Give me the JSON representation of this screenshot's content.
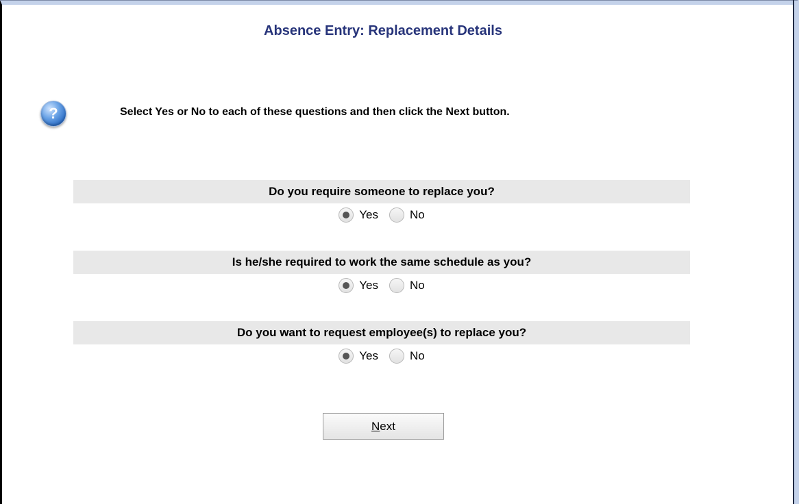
{
  "page": {
    "title": "Absence Entry: Replacement Details",
    "instruction": "Select Yes or No to each of these questions and then click the Next button.",
    "help_icon_glyph": "?"
  },
  "questions": [
    {
      "text": "Do you require someone to replace you?",
      "options": [
        {
          "label": "Yes",
          "selected": true
        },
        {
          "label": "No",
          "selected": false
        }
      ]
    },
    {
      "text": "Is he/she required to work the same schedule as you?",
      "options": [
        {
          "label": "Yes",
          "selected": true
        },
        {
          "label": "No",
          "selected": false
        }
      ]
    },
    {
      "text": "Do you want to request employee(s) to replace you?",
      "options": [
        {
          "label": "Yes",
          "selected": true
        },
        {
          "label": "No",
          "selected": false
        }
      ]
    }
  ],
  "next_button": {
    "accel": "N",
    "rest": "ext"
  },
  "colors": {
    "title": "#27347a",
    "question_bar": "#e8e8e8",
    "frame": "#c4d2ea"
  }
}
